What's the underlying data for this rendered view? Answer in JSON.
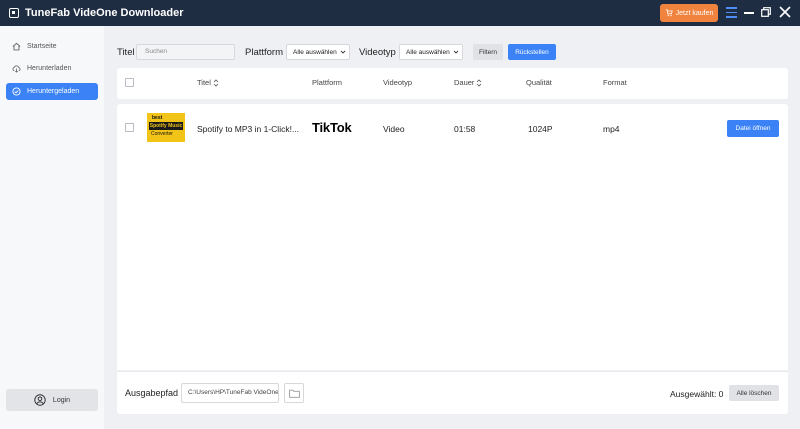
{
  "app": {
    "title": "TuneFab VideOne Downloader",
    "buy_label": "Jetzt kaufen"
  },
  "colors": {
    "titlebar": "#1f2d42",
    "accent": "#3b82f6",
    "buy": "#f0833e"
  },
  "sidebar": {
    "items": [
      {
        "label": "Startseite",
        "icon": "home-icon"
      },
      {
        "label": "Herunterladen",
        "icon": "cloud-download-icon"
      },
      {
        "label": "Heruntergeladen",
        "icon": "check-circle-icon",
        "active": true
      }
    ],
    "login_label": "Login"
  },
  "filters": {
    "title_label": "Titel",
    "search_placeholder": "Suchen",
    "platform_label": "Plattform",
    "platform_value": "Alle auswählen",
    "videotype_label": "Videotyp",
    "videotype_value": "Alle auswählen",
    "filter_button": "Filtern",
    "reset_button": "Rückstellen"
  },
  "table": {
    "columns": {
      "title": "Titel",
      "platform": "Plattform",
      "videotype": "Videotyp",
      "duration": "Dauer",
      "quality": "Qualität",
      "format": "Format"
    },
    "rows": [
      {
        "thumbnail_text": [
          "best",
          "Spotify Music",
          "Converter"
        ],
        "title": "Spotify to MP3 in 1-Click!...",
        "platform": "TikTok",
        "videotype": "Video",
        "duration": "01:58",
        "quality": "1024P",
        "format": "mp4",
        "action": "Datei öffnen"
      }
    ]
  },
  "footer": {
    "output_label": "Ausgabepfad",
    "output_path": "C:\\Users\\HP\\TuneFab VideOne",
    "selected_label": "Ausgewählt: 0",
    "delete_all": "Alle löschen"
  }
}
